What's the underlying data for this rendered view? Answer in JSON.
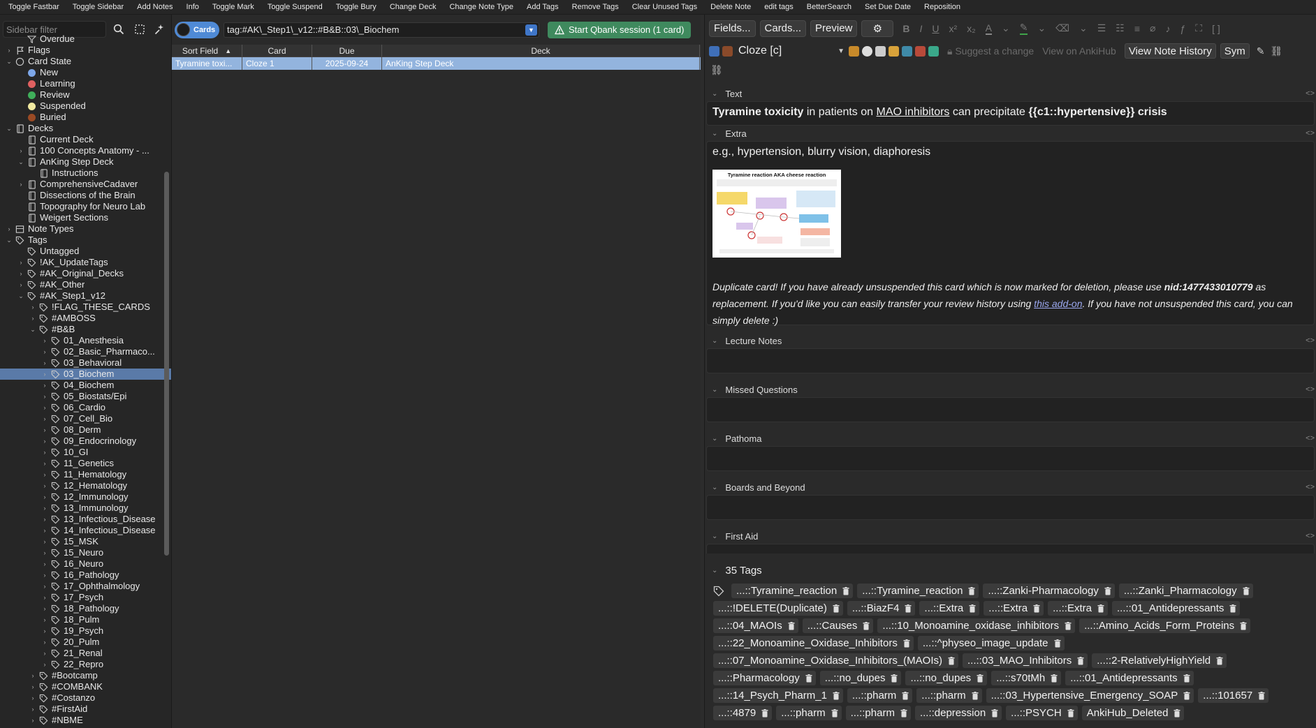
{
  "toolbar": [
    "Toggle Fastbar",
    "Toggle Sidebar",
    "Add Notes",
    "Info",
    "Toggle Mark",
    "Toggle Suspend",
    "Toggle Bury",
    "Change Deck",
    "Change Note Type",
    "Add Tags",
    "Remove Tags",
    "Clear Unused Tags",
    "Delete Note",
    "edit tags",
    "BetterSearch",
    "Set Due Date",
    "Reposition"
  ],
  "sidebar": {
    "filter_placeholder": "Sidebar filter",
    "tree": [
      {
        "label": "Overdue",
        "indent": 1,
        "chev": "",
        "icon": "filter"
      },
      {
        "label": "Flags",
        "indent": 0,
        "chev": "›",
        "icon": "flag"
      },
      {
        "label": "Card State",
        "indent": 0,
        "chev": "⌄",
        "icon": "circle"
      },
      {
        "label": "New",
        "indent": 1,
        "chev": "",
        "icon": "dot",
        "color": "#7da7e8"
      },
      {
        "label": "Learning",
        "indent": 1,
        "chev": "",
        "icon": "dot",
        "color": "#e06060"
      },
      {
        "label": "Review",
        "indent": 1,
        "chev": "",
        "icon": "dot",
        "color": "#3fae5a"
      },
      {
        "label": "Suspended",
        "indent": 1,
        "chev": "",
        "icon": "dot",
        "color": "#f1e9a0"
      },
      {
        "label": "Buried",
        "indent": 1,
        "chev": "",
        "icon": "dot",
        "color": "#9a4a24"
      },
      {
        "label": "Decks",
        "indent": 0,
        "chev": "⌄",
        "icon": "deck"
      },
      {
        "label": "Current Deck",
        "indent": 1,
        "chev": "",
        "icon": "deck"
      },
      {
        "label": "100 Concepts Anatomy - ...",
        "indent": 1,
        "chev": "›",
        "icon": "deck"
      },
      {
        "label": "AnKing Step Deck",
        "indent": 1,
        "chev": "⌄",
        "icon": "deck"
      },
      {
        "label": "Instructions",
        "indent": 2,
        "chev": "",
        "icon": "deck"
      },
      {
        "label": "ComprehensiveCadaver",
        "indent": 1,
        "chev": "›",
        "icon": "deck"
      },
      {
        "label": "Dissections of the Brain",
        "indent": 1,
        "chev": "",
        "icon": "deck"
      },
      {
        "label": "Topography for Neuro Lab",
        "indent": 1,
        "chev": "",
        "icon": "deck"
      },
      {
        "label": "Weigert Sections",
        "indent": 1,
        "chev": "",
        "icon": "deck"
      },
      {
        "label": "Note Types",
        "indent": 0,
        "chev": "›",
        "icon": "notetype"
      },
      {
        "label": "Tags",
        "indent": 0,
        "chev": "⌄",
        "icon": "tag"
      },
      {
        "label": "Untagged",
        "indent": 1,
        "chev": "",
        "icon": "tag"
      },
      {
        "label": "!AK_UpdateTags",
        "indent": 1,
        "chev": "›",
        "icon": "tag"
      },
      {
        "label": "#AK_Original_Decks",
        "indent": 1,
        "chev": "›",
        "icon": "tag"
      },
      {
        "label": "#AK_Other",
        "indent": 1,
        "chev": "›",
        "icon": "tag"
      },
      {
        "label": "#AK_Step1_v12",
        "indent": 1,
        "chev": "⌄",
        "icon": "tag"
      },
      {
        "label": "!FLAG_THESE_CARDS",
        "indent": 2,
        "chev": "›",
        "icon": "tag"
      },
      {
        "label": "#AMBOSS",
        "indent": 2,
        "chev": "›",
        "icon": "tag"
      },
      {
        "label": "#B&B",
        "indent": 2,
        "chev": "⌄",
        "icon": "tag"
      },
      {
        "label": "01_Anesthesia",
        "indent": 3,
        "chev": "›",
        "icon": "tag"
      },
      {
        "label": "02_Basic_Pharmaco...",
        "indent": 3,
        "chev": "›",
        "icon": "tag"
      },
      {
        "label": "03_Behavioral",
        "indent": 3,
        "chev": "›",
        "icon": "tag"
      },
      {
        "label": "03_Biochem",
        "indent": 3,
        "chev": "›",
        "icon": "tag",
        "selected": true
      },
      {
        "label": "04_Biochem",
        "indent": 3,
        "chev": "›",
        "icon": "tag"
      },
      {
        "label": "05_Biostats/Epi",
        "indent": 3,
        "chev": "›",
        "icon": "tag"
      },
      {
        "label": "06_Cardio",
        "indent": 3,
        "chev": "›",
        "icon": "tag"
      },
      {
        "label": "07_Cell_Bio",
        "indent": 3,
        "chev": "›",
        "icon": "tag"
      },
      {
        "label": "08_Derm",
        "indent": 3,
        "chev": "›",
        "icon": "tag"
      },
      {
        "label": "09_Endocrinology",
        "indent": 3,
        "chev": "›",
        "icon": "tag"
      },
      {
        "label": "10_GI",
        "indent": 3,
        "chev": "›",
        "icon": "tag"
      },
      {
        "label": "11_Genetics",
        "indent": 3,
        "chev": "›",
        "icon": "tag"
      },
      {
        "label": "11_Hematology",
        "indent": 3,
        "chev": "›",
        "icon": "tag"
      },
      {
        "label": "12_Hematology",
        "indent": 3,
        "chev": "›",
        "icon": "tag"
      },
      {
        "label": "12_Immunology",
        "indent": 3,
        "chev": "›",
        "icon": "tag"
      },
      {
        "label": "13_Immunology",
        "indent": 3,
        "chev": "›",
        "icon": "tag"
      },
      {
        "label": "13_Infectious_Disease",
        "indent": 3,
        "chev": "›",
        "icon": "tag"
      },
      {
        "label": "14_Infectious_Disease",
        "indent": 3,
        "chev": "›",
        "icon": "tag"
      },
      {
        "label": "15_MSK",
        "indent": 3,
        "chev": "›",
        "icon": "tag"
      },
      {
        "label": "15_Neuro",
        "indent": 3,
        "chev": "›",
        "icon": "tag"
      },
      {
        "label": "16_Neuro",
        "indent": 3,
        "chev": "›",
        "icon": "tag"
      },
      {
        "label": "16_Pathology",
        "indent": 3,
        "chev": "›",
        "icon": "tag"
      },
      {
        "label": "17_Ophthalmology",
        "indent": 3,
        "chev": "›",
        "icon": "tag"
      },
      {
        "label": "17_Psych",
        "indent": 3,
        "chev": "›",
        "icon": "tag"
      },
      {
        "label": "18_Pathology",
        "indent": 3,
        "chev": "›",
        "icon": "tag"
      },
      {
        "label": "18_Pulm",
        "indent": 3,
        "chev": "›",
        "icon": "tag"
      },
      {
        "label": "19_Psych",
        "indent": 3,
        "chev": "›",
        "icon": "tag"
      },
      {
        "label": "20_Pulm",
        "indent": 3,
        "chev": "›",
        "icon": "tag"
      },
      {
        "label": "21_Renal",
        "indent": 3,
        "chev": "›",
        "icon": "tag"
      },
      {
        "label": "22_Repro",
        "indent": 3,
        "chev": "›",
        "icon": "tag"
      },
      {
        "label": "#Bootcamp",
        "indent": 2,
        "chev": "›",
        "icon": "tag"
      },
      {
        "label": "#COMBANK",
        "indent": 2,
        "chev": "›",
        "icon": "tag"
      },
      {
        "label": "#Costanzo",
        "indent": 2,
        "chev": "›",
        "icon": "tag"
      },
      {
        "label": "#FirstAid",
        "indent": 2,
        "chev": "›",
        "icon": "tag"
      },
      {
        "label": "#NBME",
        "indent": 2,
        "chev": "›",
        "icon": "tag"
      }
    ]
  },
  "browser": {
    "toggle_label": "Cards",
    "search_value": "tag:#AK\\_Step1\\_v12::#B&B::03\\_Biochem",
    "qbank_label": "Start Qbank session (1 card)",
    "columns": [
      "Sort Field",
      "Card",
      "Due",
      "Deck"
    ],
    "rows": [
      {
        "sort_field": "Tyramine toxi...",
        "card": "Cloze 1",
        "due": "2025-09-24",
        "deck": "AnKing Step Deck"
      }
    ]
  },
  "editor": {
    "fields_btn": "Fields...",
    "cards_btn": "Cards...",
    "preview_btn": "Preview",
    "notetype": "Cloze [c]",
    "suggest_change": "Suggest a change",
    "view_on_ankihub": "View on AnkiHub",
    "view_history": "View Note History",
    "sym_btn": "Sym",
    "fields": {
      "text_name": "Text",
      "text_bold1": "Tyramine toxicity",
      "text_mid1": " in patients on ",
      "text_link": "MAO inhibitors",
      "text_mid2": " can precipitate ",
      "text_cloze": "{{c1::hypertensive}} crisis",
      "extra_name": "Extra",
      "extra_text": "e.g., hypertension, blurry vision, diaphoresis",
      "diagram_title": "Tyramine reaction AKA cheese reaction",
      "dup_1": "Duplicate card! If you have already unsuspended this card which is now marked for deletion, please use ",
      "dup_nid": "nid:1477433010779",
      "dup_2": " as replacement. If you'd like you can easily transfer your review history using ",
      "dup_link": "this add-on",
      "dup_3": ". If you have not unsuspended this card, you can simply delete :)",
      "lecture_name": "Lecture Notes",
      "missed_name": "Missed Questions",
      "pathoma_name": "Pathoma",
      "boards_name": "Boards and Beyond",
      "firstaid_name": "First Aid"
    },
    "tags_header": "35 Tags",
    "tags": [
      "...::Tyramine_reaction",
      "...::Tyramine_reaction",
      "...::Zanki-Pharmacology",
      "...::Zanki_Pharmacology",
      "...::!DELETE(Duplicate)",
      "...::BiazF4",
      "...::Extra",
      "...::Extra",
      "...::Extra",
      "...::01_Antidepressants",
      "...::04_MAOIs",
      "...::Causes",
      "...::10_Monoamine_oxidase_inhibitors",
      "...::Amino_Acids_Form_Proteins",
      "...::22_Monoamine_Oxidase_Inhibitors",
      "...::^physeo_image_update",
      "...::07_Monoamine_Oxidase_Inhibitors_(MAOIs)",
      "...::03_MAO_Inhibitors",
      "...::2-RelativelyHighYield",
      "...::Pharmacology",
      "...::no_dupes",
      "...::no_dupes",
      "...::s70tMh",
      "...::01_Antidepressants",
      "...::14_Psych_Pharm_1",
      "...::pharm",
      "...::pharm",
      "...::03_Hypertensive_Emergency_SOAP",
      "...::101657",
      "...::4879",
      "...::pharm",
      "...::pharm",
      "...::depression",
      "...::PSYCH",
      "AnkiHub_Deleted"
    ]
  }
}
